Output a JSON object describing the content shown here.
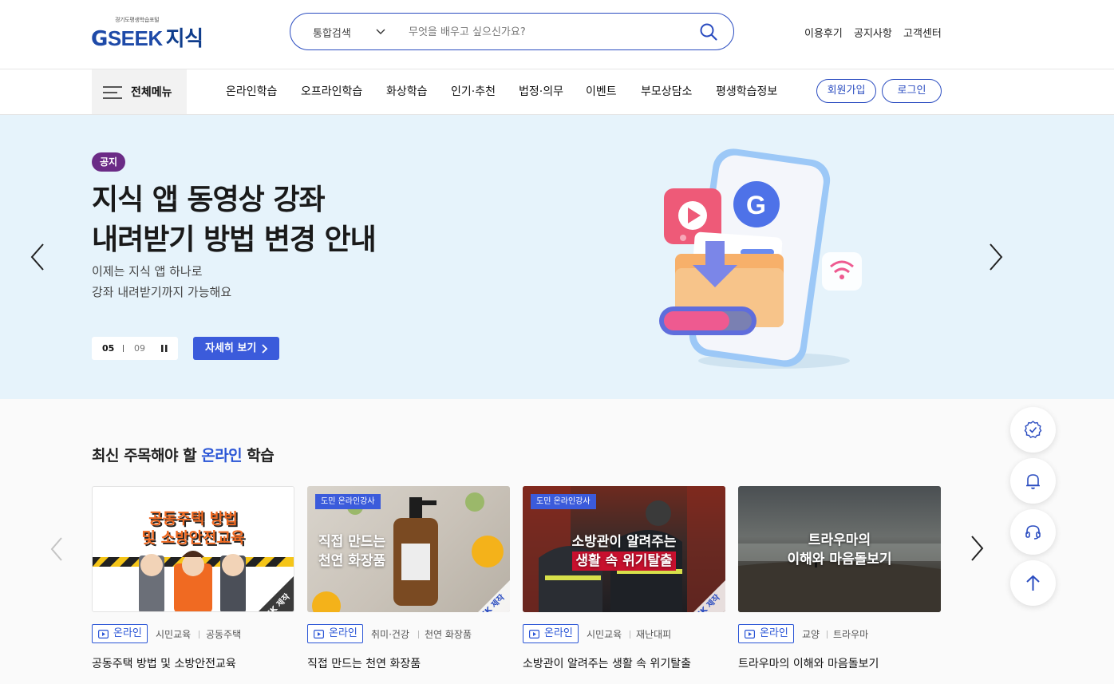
{
  "header": {
    "logo_sub": "경기도평생학습포털",
    "logo_g": "G",
    "logo_seek": "SEEK",
    "logo_ko": "지식",
    "search_scope": "통합검색",
    "search_placeholder": "무엇을 배우고 싶으신가요?",
    "util_links": [
      "이용후기",
      "공지사항",
      "고객센터"
    ]
  },
  "nav": {
    "all_menu": "전체메뉴",
    "items": [
      "온라인학습",
      "오프라인학습",
      "화상학습",
      "인기·추천",
      "법정·의무",
      "이벤트",
      "부모상담소",
      "평생학습정보"
    ],
    "signup": "회원가입",
    "login": "로그인"
  },
  "hero": {
    "badge": "공지",
    "title_line1": "지식 앱 동영상 강좌",
    "title_line2": "내려받기 방법 변경 안내",
    "desc_line1": "이제는 지식 앱 하나로",
    "desc_line2": "강좌 내려받기까지 가능해요",
    "page_current": "05",
    "page_total": "09",
    "more_label": "자세히 보기"
  },
  "section": {
    "title_pre": "최신 주목해야 할 ",
    "title_hl": "온라인",
    "title_post": " 학습",
    "cards": [
      {
        "thumb_line1": "공동주택 방법",
        "thumb_line2": "및 소방안전교육",
        "thumb_watermark": "GSEEK 제작",
        "tag": "",
        "online_label": "온라인",
        "cat1": "시민교육",
        "cat2": "공동주택",
        "title": "공동주택 방법 및 소방안전교육"
      },
      {
        "thumb_line1": "직접 만드는",
        "thumb_line2": "천연 화장품",
        "thumb_watermark": "GSEEK 제작",
        "tag": "도민 온라인강사",
        "online_label": "온라인",
        "cat1": "취미·건강",
        "cat2": "천연 화장품",
        "title": "직접 만드는 천연 화장품"
      },
      {
        "thumb_line1": "소방관이 알려주는",
        "thumb_line2": "생활 속 위기탈출",
        "thumb_watermark": "GSEEK 제작",
        "tag": "도민 온라인강사",
        "online_label": "온라인",
        "cat1": "시민교육",
        "cat2": "재난대피",
        "title": "소방관이 알려주는 생활 속 위기탈출"
      },
      {
        "thumb_line1": "트라우마의",
        "thumb_line2": "이해와 마음돌보기",
        "thumb_watermark": "",
        "tag": "",
        "online_label": "온라인",
        "cat1": "교양",
        "cat2": "트라우마",
        "title": "트라우마의 이해와 마음돌보기"
      }
    ]
  },
  "colors": {
    "primary": "#2a4cc0",
    "hero_bg": "#e6f3fb",
    "badge": "#6b2b86",
    "accent_text": "#2a55d6"
  },
  "icons": {
    "search": "search-icon",
    "hamburger": "hamburger-icon",
    "prev": "chevron-left-icon",
    "next": "chevron-right-icon",
    "pause": "pause-icon",
    "play": "play-icon",
    "certificate": "certificate-icon",
    "bell": "bell-icon",
    "headset": "headset-icon",
    "top": "arrow-up-icon"
  }
}
